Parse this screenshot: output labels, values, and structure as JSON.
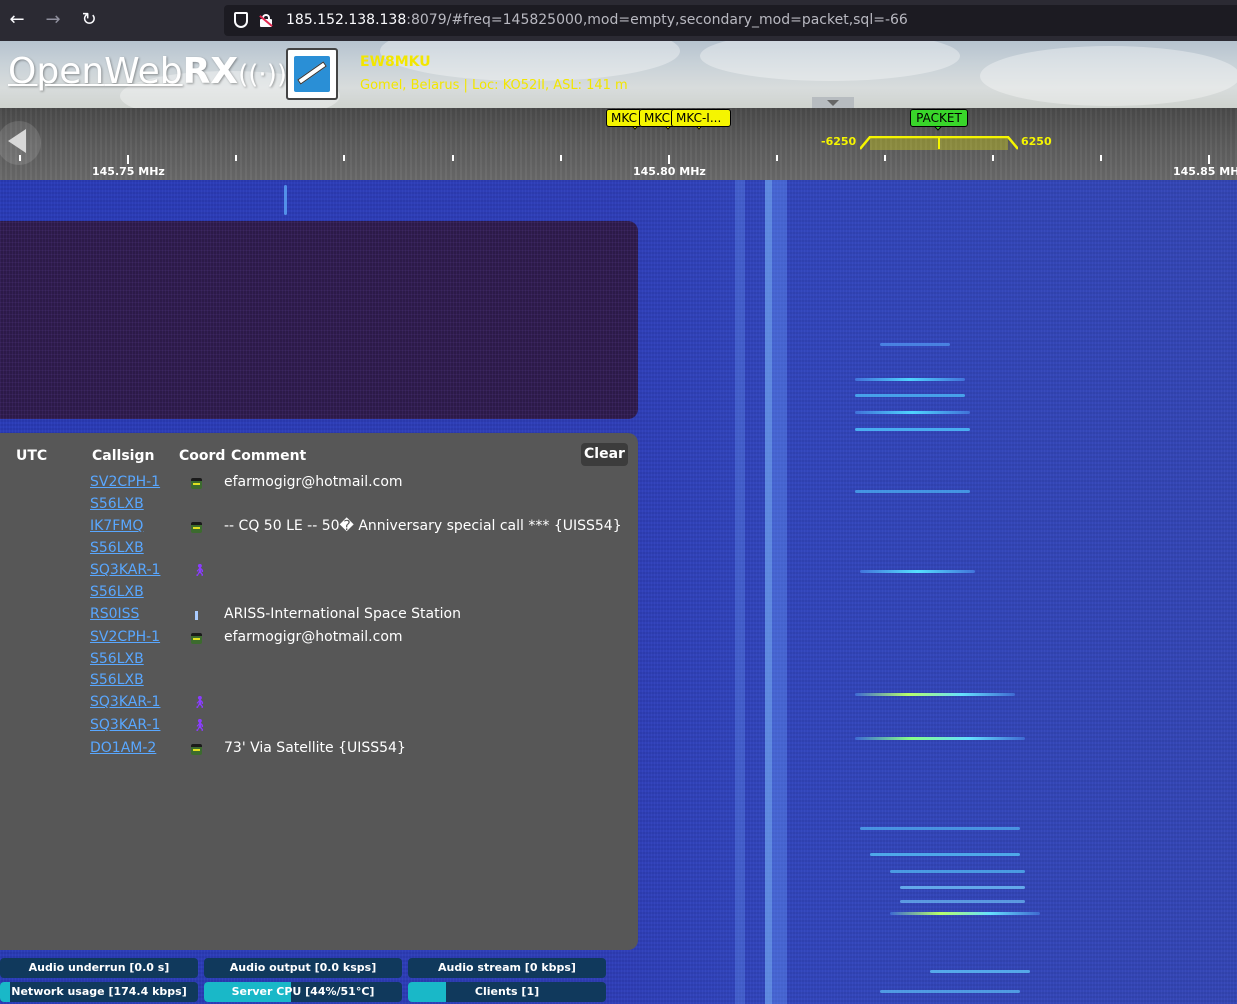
{
  "browser": {
    "url_host": "185.152.138.138",
    "url_rest": ":8079/#freq=145825000,mod=empty,secondary_mod=packet,sql=-66"
  },
  "header": {
    "logo_open": "Open",
    "logo_web": "Web",
    "logo_rx": "RX",
    "callsign": "EW8MKU",
    "description": "Gomel, Belarus | Loc: KO52II, ASL: 141 m"
  },
  "scale": {
    "labels": [
      "145.75 MHz",
      "145.80 MHz",
      "145.85 MH"
    ],
    "markers": [
      "MKC",
      "MKC",
      "MKC-I..."
    ],
    "packet_marker": "PACKET",
    "bw_low": "-6250",
    "bw_high": "6250"
  },
  "log": {
    "columns": {
      "utc": "UTC",
      "callsign": "Callsign",
      "coord": "Coord",
      "comment": "Comment"
    },
    "clear_label": "Clear",
    "rows": [
      {
        "call": "SV2CPH-1",
        "symbol": "car-icon",
        "comment": "efarmogigr@hotmail.com"
      },
      {
        "call": "S56LXB",
        "symbol": "",
        "comment": ""
      },
      {
        "call": "IK7FMQ",
        "symbol": "car-icon",
        "comment": "-- CQ 50 LE -- 50� Anniversary special call *** {UISS54}"
      },
      {
        "call": "S56LXB",
        "symbol": "",
        "comment": ""
      },
      {
        "call": "SQ3KAR-1",
        "symbol": "walker-icon",
        "comment": ""
      },
      {
        "call": "S56LXB",
        "symbol": "",
        "comment": ""
      },
      {
        "call": "RS0ISS",
        "symbol": "satellite-icon",
        "comment": "ARISS-International Space Station"
      },
      {
        "call": "SV2CPH-1",
        "symbol": "car-icon",
        "comment": "efarmogigr@hotmail.com"
      },
      {
        "call": "S56LXB",
        "symbol": "",
        "comment": ""
      },
      {
        "call": "S56LXB",
        "symbol": "",
        "comment": ""
      },
      {
        "call": "SQ3KAR-1",
        "symbol": "walker-icon",
        "comment": ""
      },
      {
        "call": "SQ3KAR-1",
        "symbol": "walker-icon",
        "comment": ""
      },
      {
        "call": "DO1AM-2",
        "symbol": "car-icon",
        "comment": "73' Via Satellite {UISS54}"
      }
    ]
  },
  "status": {
    "audio_underrun": "Audio underrun [0.0 s]",
    "audio_output": "Audio output [0.0 ksps]",
    "audio_stream": "Audio stream [0 kbps]",
    "network_usage": "Network usage [174.4 kbps]",
    "server_cpu": "Server CPU [44%/51°C]",
    "clients": "Clients [1]",
    "network_fill_pct": 5,
    "cpu_fill_pct": 44,
    "clients_fill_pct": 19
  },
  "colors": {
    "station_text": "#f2e600",
    "marker": "#f5f500",
    "packet_marker": "#39d62a",
    "link": "#59a7ff",
    "status_bg": "#10395c",
    "status_fill": "#19b8c8"
  }
}
